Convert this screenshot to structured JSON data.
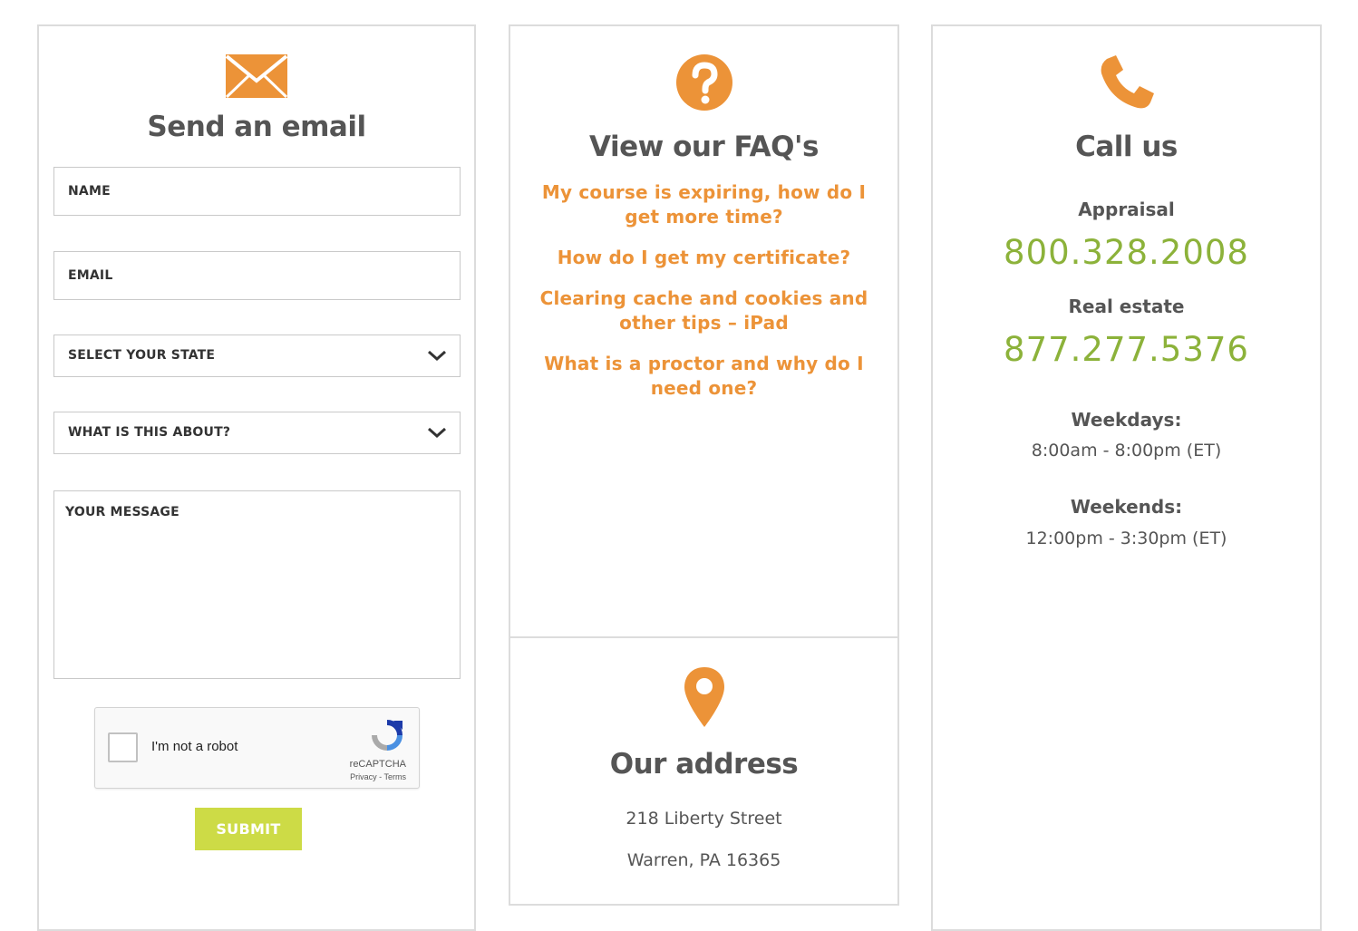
{
  "colors": {
    "accent_orange": "#ec9338",
    "phone_green": "#8cb23a",
    "submit_green": "#cddb46",
    "title_gray": "#555555"
  },
  "email": {
    "icon": "envelope-icon",
    "title": "Send an email",
    "name_placeholder": "NAME",
    "email_placeholder": "EMAIL",
    "state_select": "SELECT YOUR STATE",
    "topic_select": "WHAT IS THIS ABOUT?",
    "message_placeholder": "YOUR MESSAGE",
    "recaptcha": {
      "label": "I'm not a robot",
      "brand": "reCAPTCHA",
      "links": "Privacy - Terms"
    },
    "submit_label": "SUBMIT"
  },
  "faq": {
    "icon": "question-circle-icon",
    "title": "View our FAQ's",
    "links": [
      "My course is expiring, how do I get more time?",
      "How do I get my certificate?",
      "Clearing cache and cookies and other tips – iPad",
      "What is a proctor and why do I need one?"
    ]
  },
  "address": {
    "icon": "map-pin-icon",
    "title": "Our address",
    "line1": "218 Liberty Street",
    "line2": "Warren, PA 16365"
  },
  "call": {
    "icon": "phone-icon",
    "title": "Call us",
    "appraisal_label": "Appraisal",
    "appraisal_phone": "800.328.2008",
    "realestate_label": "Real estate",
    "realestate_phone": "877.277.5376",
    "weekdays_label": "Weekdays:",
    "weekdays_hours": "8:00am - 8:00pm (ET)",
    "weekends_label": "Weekends:",
    "weekends_hours": "12:00pm - 3:30pm (ET)"
  }
}
